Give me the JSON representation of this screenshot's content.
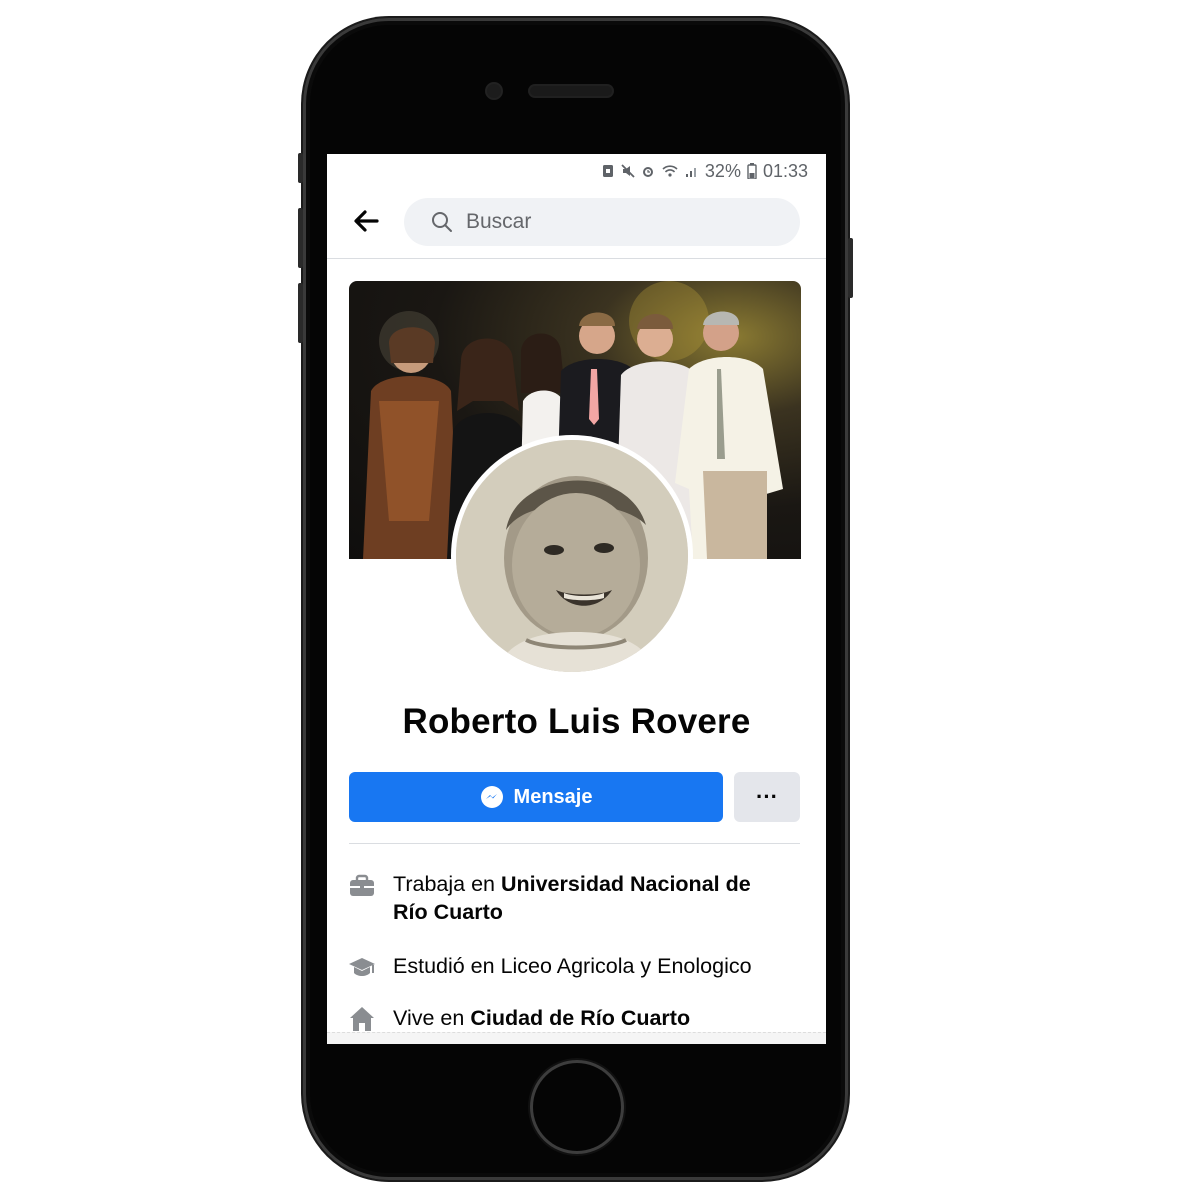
{
  "status_bar": {
    "battery": "32%",
    "time": "01:33",
    "icons": [
      "save-icon",
      "mute-icon",
      "alarm-icon",
      "wifi-icon",
      "signal-icon",
      "battery-icon"
    ]
  },
  "header": {
    "back_icon": "arrow-left-icon",
    "search_placeholder": "Buscar"
  },
  "profile": {
    "name": "Roberto Luis Rovere",
    "message_label": "Mensaje",
    "more_label": "···"
  },
  "details": [
    {
      "icon": "briefcase-icon",
      "prefix": "Trabaja en ",
      "value": "Universidad Nacional de",
      "value2": "Río Cuarto"
    },
    {
      "icon": "graduation-cap-icon",
      "prefix": "Estudió en Liceo Agricola y Enologico",
      "value": ""
    },
    {
      "icon": "home-icon",
      "prefix": "Vive en ",
      "value": "Ciudad de Río Cuarto"
    }
  ],
  "colors": {
    "accent": "#1877f2",
    "secondary_button": "#e4e6eb",
    "text": "#050505",
    "muted": "#65676b"
  }
}
